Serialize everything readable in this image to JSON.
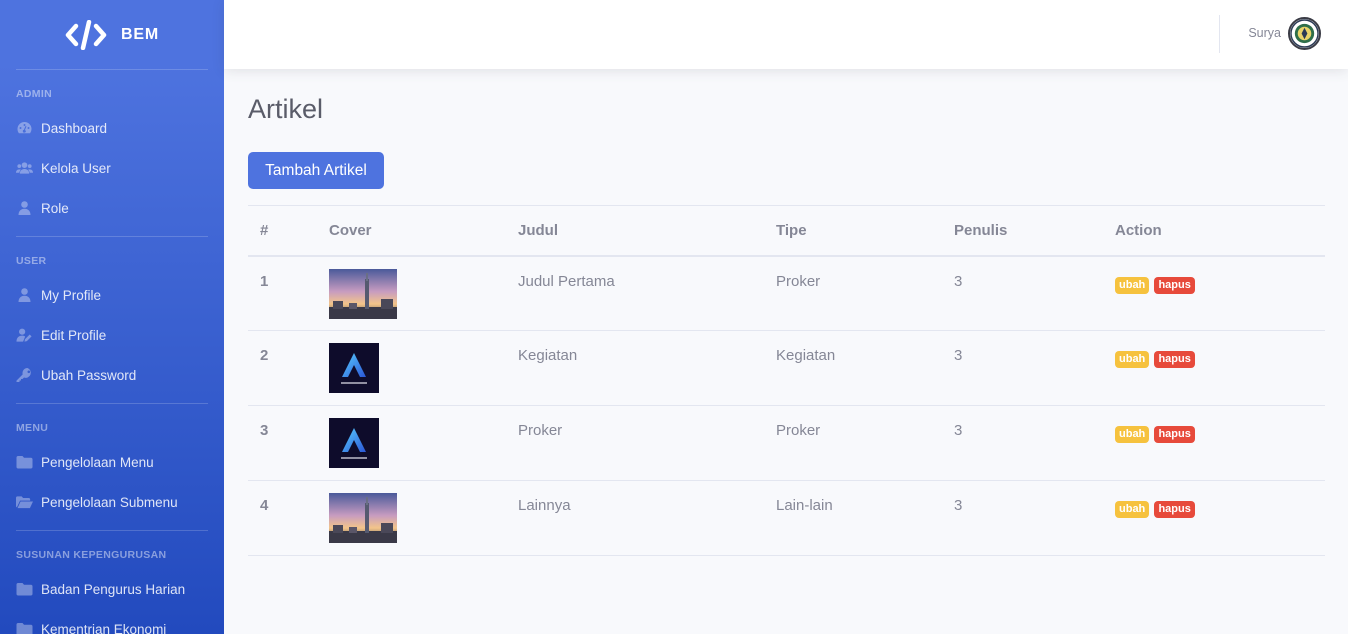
{
  "brand": {
    "name": "BEM",
    "icon": "code-icon"
  },
  "sidebar": {
    "sections": [
      {
        "heading": "Admin",
        "items": [
          {
            "label": "Dashboard",
            "icon": "tachometer-icon"
          },
          {
            "label": "Kelola User",
            "icon": "users-icon"
          },
          {
            "label": "Role",
            "icon": "user-icon"
          }
        ]
      },
      {
        "heading": "User",
        "items": [
          {
            "label": "My Profile",
            "icon": "user-icon"
          },
          {
            "label": "Edit Profile",
            "icon": "user-edit-icon"
          },
          {
            "label": "Ubah Password",
            "icon": "key-icon"
          }
        ]
      },
      {
        "heading": "Menu",
        "items": [
          {
            "label": "Pengelolaan Menu",
            "icon": "folder-icon"
          },
          {
            "label": "Pengelolaan Submenu",
            "icon": "folder-open-icon"
          }
        ]
      },
      {
        "heading": "Susunan Kepengurusan",
        "items": [
          {
            "label": "Badan Pengurus Harian",
            "icon": "folder-icon"
          },
          {
            "label": "Kementrian Ekonomi",
            "icon": "folder-icon"
          }
        ]
      }
    ]
  },
  "topbar": {
    "user_name": "Surya",
    "avatar_icon": "university-seal-icon"
  },
  "page": {
    "title": "Artikel",
    "add_button": "Tambah Artikel"
  },
  "table": {
    "headers": [
      "#",
      "Cover",
      "Judul",
      "Tipe",
      "Penulis",
      "Action"
    ],
    "rows": [
      {
        "no": "1",
        "cover": "city-tower-photo",
        "judul": "Judul Pertama",
        "tipe": "Proker",
        "penulis": "3",
        "edit": "ubah",
        "delete": "hapus"
      },
      {
        "no": "2",
        "cover": "arpra-creative-logo",
        "judul": "Kegiatan",
        "tipe": "Kegiatan",
        "penulis": "3",
        "edit": "ubah",
        "delete": "hapus"
      },
      {
        "no": "3",
        "cover": "arpra-creative-logo",
        "judul": "Proker",
        "tipe": "Proker",
        "penulis": "3",
        "edit": "ubah",
        "delete": "hapus"
      },
      {
        "no": "4",
        "cover": "city-tower-photo",
        "judul": "Lainnya",
        "tipe": "Lain-lain",
        "penulis": "3",
        "edit": "ubah",
        "delete": "hapus"
      }
    ]
  },
  "colors": {
    "primary": "#4e73df",
    "warning": "#f6c23e",
    "danger": "#e74a3b"
  }
}
